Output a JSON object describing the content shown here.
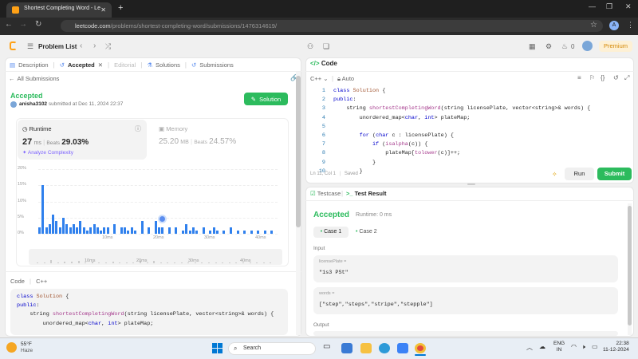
{
  "browser": {
    "tab_title": "Shortest Completing Word - Le",
    "url_domain": "leetcode.com",
    "url_path": "/problems/shortest-completing-word/submissions/1476314619/",
    "profile": "A"
  },
  "header": {
    "problem_list": "Problem List",
    "timer": "0",
    "premium": "Premium"
  },
  "left_tabs": {
    "description": "Description",
    "accepted": "Accepted",
    "editorial": "Editorial",
    "solutions": "Solutions",
    "submissions": "Submissions"
  },
  "submission": {
    "back": "All Submissions",
    "status": "Accepted",
    "user": "anisha3102",
    "submitted": "submitted at Dec 11, 2024 22:37",
    "solution_btn": "Solution"
  },
  "runtime": {
    "label": "Runtime",
    "value": "27",
    "unit": "ms",
    "beats_label": "Beats",
    "beats": "29.03%",
    "analyze": "Analyze Complexity"
  },
  "memory": {
    "label": "Memory",
    "value": "25.20",
    "unit": "MB",
    "beats_label": "Beats",
    "beats": "24.57%"
  },
  "chart_data": {
    "type": "bar",
    "y_ticks": [
      "20%",
      "15%",
      "10%",
      "5%",
      "0%"
    ],
    "x_ticks": [
      "10ms",
      "20ms",
      "30ms",
      "40ms"
    ],
    "ylim": [
      0,
      20
    ],
    "values": [
      2,
      15,
      2,
      3,
      6,
      4,
      2,
      5,
      3,
      2,
      3,
      2,
      4,
      2,
      1,
      2,
      3,
      2,
      1,
      2,
      2,
      1,
      3,
      1,
      2,
      2,
      1,
      2,
      1,
      1,
      4,
      1,
      2,
      1,
      4,
      2,
      2,
      1,
      2,
      1,
      2,
      1,
      1,
      3,
      1,
      2,
      1,
      1,
      2,
      1,
      1,
      2,
      1,
      1,
      1,
      1,
      2,
      1,
      1,
      1,
      1,
      1,
      1,
      1,
      1,
      1,
      1,
      1,
      1,
      1
    ],
    "highlight_index": 36,
    "mini_x_ticks": [
      "10ms",
      "20ms",
      "30ms",
      "40ms"
    ]
  },
  "left_code": {
    "label": "Code",
    "lang": "C++",
    "lines": [
      "class Solution {",
      "public:",
      "    string shortestCompletingWord(string licensePlate, vector<string>& words) {",
      "        unordered_map<char, int> plateMap;"
    ]
  },
  "right": {
    "code_tab": "Code",
    "lang": "C++",
    "auto": "Auto",
    "status": "Ln 11, Col 1",
    "saved": "Saved",
    "run": "Run",
    "submit": "Submit"
  },
  "editor_lines": [
    {
      "n": "1",
      "t": "class Solution {"
    },
    {
      "n": "2",
      "t": "public:"
    },
    {
      "n": "3",
      "t": "    string shortestCompletingWord(string licensePlate, vector<string>& words) {"
    },
    {
      "n": "4",
      "t": "        unordered_map<char, int> plateMap;"
    },
    {
      "n": "5",
      "t": ""
    },
    {
      "n": "6",
      "t": "        for (char c : licensePlate) {"
    },
    {
      "n": "7",
      "t": "            if (isalpha(c)) {"
    },
    {
      "n": "8",
      "t": "                plateMap[tolower(c)]++;"
    },
    {
      "n": "9",
      "t": "            }"
    },
    {
      "n": "10",
      "t": "        }"
    }
  ],
  "result": {
    "testcase_tab": "Testcase",
    "result_tab": "Test Result",
    "status": "Accepted",
    "runtime": "Runtime: 0 ms",
    "case1": "Case 1",
    "case2": "Case 2",
    "input_label": "Input",
    "p1_label": "licensePlate =",
    "p1_value": "\"1s3 PSt\"",
    "p2_label": "words =",
    "p2_value": "[\"step\",\"steps\",\"stripe\",\"stepple\"]",
    "output_label": "Output"
  },
  "taskbar": {
    "temp": "55°F",
    "weather": "Haze",
    "search": "Search",
    "lang1": "ENG",
    "lang2": "IN",
    "time": "22:38",
    "date": "11-12-2024"
  }
}
